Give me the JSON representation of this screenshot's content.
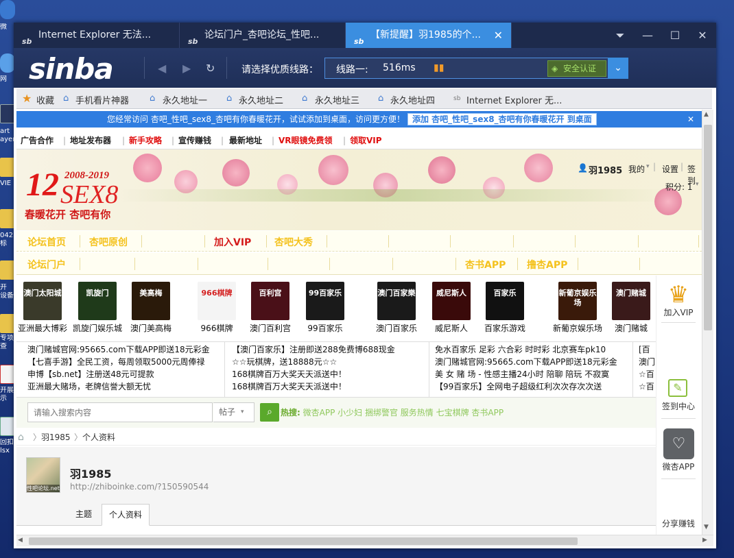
{
  "browser": {
    "tabs": [
      {
        "label": "Internet Explorer 无法..."
      },
      {
        "label": "论坛门户_杏吧论坛_性吧..."
      },
      {
        "label": "【新提醒】羽1985的个..."
      }
    ],
    "logo": "sinba",
    "line_label": "请选择优质线路：",
    "line_name": "线路一:",
    "latency": "516ms",
    "safe_label": "安全认证",
    "favorites": [
      "收藏",
      "手机看片神器",
      "永久地址一",
      "永久地址二",
      "永久地址三",
      "永久地址四",
      "Internet Explorer 无..."
    ]
  },
  "desktop": {
    "labels": [
      "微",
      "网",
      "art",
      "ayer",
      "VIE",
      "0425",
      "标",
      "开",
      "设备",
      "专项",
      "查",
      "开展",
      "示",
      "回扣",
      "lsx"
    ]
  },
  "page": {
    "notice": "您经常访问 杏吧_性吧_sex8_杏吧有你春暖花开，试试添加到桌面，访问更方便！",
    "notice_btn": "添加 杏吧_性吧_sex8_杏吧有你春暖花开 到桌面",
    "top_menu": [
      "广告合作",
      "地址发布器",
      "新手攻略",
      "宣传赚钱",
      "最新地址",
      "VR眼镜免费领",
      "领取VIP"
    ],
    "banner": {
      "years": "2008-2019",
      "brand": "SEX8",
      "num": "12",
      "slogan": "春暖花开 杏吧有你",
      "user": "羽1985",
      "my": "我的",
      "settings": "设置",
      "sign": "签到",
      "points": "积分: 1"
    },
    "nav1": [
      "论坛首页",
      "杏吧原创",
      "加入VIP",
      "杏吧大秀"
    ],
    "nav2": [
      "论坛门户",
      "杏书APP",
      "撸杏APP"
    ],
    "ads": [
      {
        "cap": "亚洲最大博彩",
        "logo": "澳门太阳城",
        "color": "#3a3a2a"
      },
      {
        "cap": "凯旋门娱乐城",
        "logo": "凯旋门",
        "color": "#1f3a1a"
      },
      {
        "cap": "澳门美高梅",
        "logo": "美高梅",
        "color": "#2a1a0a"
      },
      {
        "cap": "966棋牌",
        "logo": "966棋牌",
        "color": "#f4f4f4"
      },
      {
        "cap": "澳门百利宫",
        "logo": "百利宫",
        "color": "#4a1018"
      },
      {
        "cap": "99百家乐",
        "logo": "99百家乐",
        "color": "#1a1a1a"
      },
      {
        "cap": "澳门百家乐",
        "logo": "澳门百家樂",
        "color": "#1a1a1a"
      },
      {
        "cap": "威尼斯人",
        "logo": "威尼斯人",
        "color": "#3a0a0a"
      },
      {
        "cap": "百家乐游戏",
        "logo": "百家乐",
        "color": "#111111"
      },
      {
        "cap": "新葡京娱乐场",
        "logo": "新葡京娱乐场",
        "color": "#3a1a0a"
      },
      {
        "cap": "澳门赌城",
        "logo": "澳门赌城",
        "color": "#3a1a1a"
      }
    ],
    "ad_text_col1": [
      "澳门赌城官网:95665.com下载APP即送18元彩金",
      "【七喜手游】全民工资，每周领取5000元周俸禄",
      "申博【sb.net】注册送48元可提款",
      "亚洲最大赌场，老牌信誉大额无忧"
    ],
    "ad_text_col2": [
      "【澳门百家乐】注册即送288免费博688现金",
      "☆☆玩棋牌，送18888元☆☆",
      "168棋牌百万大奖天天派送中！",
      "168棋牌百万大奖天天派送中！"
    ],
    "ad_text_col3": [
      "免水百家乐 足彩 六合彩 时时彩 北京赛车pk10",
      "澳门赌城官网:95665.com下载APP即送18元彩金",
      "美 女 赌 场 - 性感主播24小时 陪聊 陪玩 不寂寞",
      "【99百家乐】全网电子超级红利次次存次次送"
    ],
    "ad_text_col4": [
      "[百",
      "澳门",
      "☆百",
      "☆百"
    ],
    "side": {
      "vip": "加入VIP",
      "checkin": "签到中心",
      "app": "微杏APP",
      "share": "分享赚钱"
    },
    "search_placeholder": "请输入搜索内容",
    "search_type": "帖子",
    "hot_label": "热搜:",
    "hot_items": "微杏APP 小少妇 捆绑警官 服务热情 七宝棋牌 杏书APP",
    "breadcrumb": [
      "羽1985",
      "个人资料"
    ],
    "profile": {
      "name": "羽1985",
      "url": "http://zhiboinke.com/?150590544",
      "avatar_caption": "性吧论坛.net",
      "tabs": [
        "主题",
        "个人资料"
      ]
    }
  }
}
